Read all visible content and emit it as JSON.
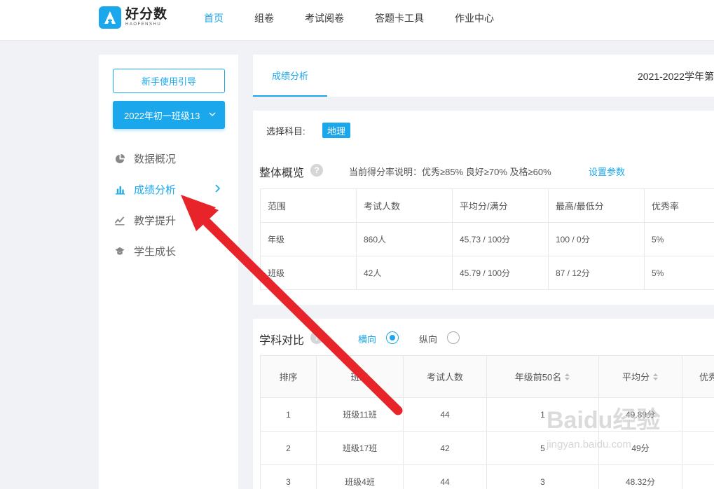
{
  "logo": {
    "cn": "好分数",
    "en": "HAOFENSHU"
  },
  "nav": [
    "首页",
    "组卷",
    "考试阅卷",
    "答题卡工具",
    "作业中心"
  ],
  "sidebar": {
    "guide_button": "新手使用引导",
    "class_select": "2022年初一班级13",
    "items": [
      "数据概况",
      "成绩分析",
      "教学提升",
      "学生成长"
    ]
  },
  "tabs": {
    "active": "成绩分析",
    "term": "2021-2022学年第"
  },
  "subject": {
    "label": "选择科目:",
    "value": "地理"
  },
  "overview": {
    "title": "整体概览",
    "rate_note": "当前得分率说明：优秀≥85%  良好≥70%  及格≥60%",
    "set_params": "设置参数",
    "headers": [
      "范围",
      "考试人数",
      "平均分/满分",
      "最高/最低分",
      "优秀率"
    ],
    "rows": [
      [
        "年级",
        "860人",
        "45.73 / 100分",
        "100 / 0分",
        "5%"
      ],
      [
        "班级",
        "42人",
        "45.79 / 100分",
        "87 / 12分",
        "5%"
      ]
    ]
  },
  "compare": {
    "title": "学科对比",
    "radio_horizontal": "横向",
    "radio_vertical": "纵向",
    "headers": [
      "排序",
      "班级",
      "考试人数",
      "年级前50名",
      "平均分",
      "优秀"
    ],
    "rows": [
      [
        "1",
        "班级11班",
        "44",
        "1",
        "49.89分",
        ""
      ],
      [
        "2",
        "班级17班",
        "42",
        "5",
        "49分",
        ""
      ],
      [
        "3",
        "班级4班",
        "44",
        "3",
        "48.32分",
        ""
      ]
    ]
  },
  "watermark": {
    "brand": "Baidu经验",
    "url": "jingyan.baidu.com"
  },
  "colors": {
    "accent": "#1aa7ec",
    "annotation_arrow": "#e8242b"
  }
}
